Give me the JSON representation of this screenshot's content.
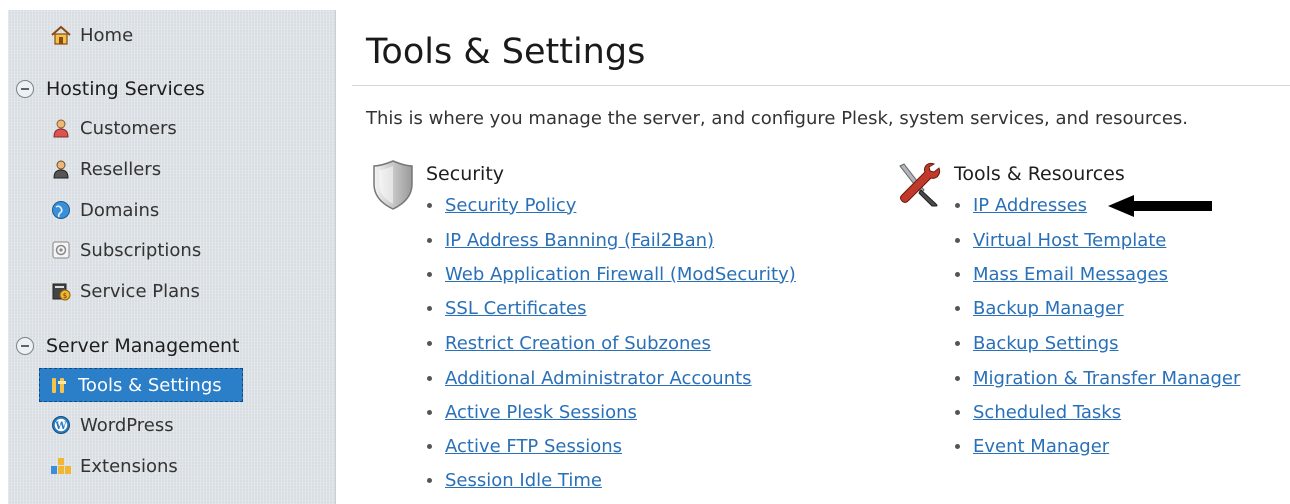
{
  "sidebar": {
    "home_label": "Home",
    "hosting": {
      "title": "Hosting Services",
      "items": [
        {
          "label": "Customers",
          "icon": "customer-icon"
        },
        {
          "label": "Resellers",
          "icon": "reseller-icon"
        },
        {
          "label": "Domains",
          "icon": "globe-icon"
        },
        {
          "label": "Subscriptions",
          "icon": "subscription-icon"
        },
        {
          "label": "Service Plans",
          "icon": "service-plans-icon"
        }
      ]
    },
    "server": {
      "title": "Server Management",
      "items": [
        {
          "label": "Tools & Settings",
          "icon": "tools-icon",
          "active": true
        },
        {
          "label": "WordPress",
          "icon": "wordpress-icon"
        },
        {
          "label": "Extensions",
          "icon": "extensions-icon"
        }
      ]
    }
  },
  "main": {
    "title": "Tools & Settings",
    "intro": "This is where you manage the server, and configure Plesk, system services, and resources.",
    "security": {
      "title": "Security",
      "links": [
        "Security Policy",
        "IP Address Banning (Fail2Ban)",
        "Web Application Firewall (ModSecurity)",
        "SSL Certificates",
        "Restrict Creation of Subzones",
        "Additional Administrator Accounts",
        "Active Plesk Sessions",
        "Active FTP Sessions",
        "Session Idle Time"
      ]
    },
    "tools": {
      "title": "Tools & Resources",
      "links": [
        "IP Addresses",
        "Virtual Host Template",
        "Mass Email Messages",
        "Backup Manager",
        "Backup Settings",
        "Migration & Transfer Manager",
        "Scheduled Tasks",
        "Event Manager"
      ]
    }
  },
  "colors": {
    "link": "#2970b8",
    "active_bg": "#2b7ec8",
    "sidebar_bg": "#dde2e7"
  }
}
